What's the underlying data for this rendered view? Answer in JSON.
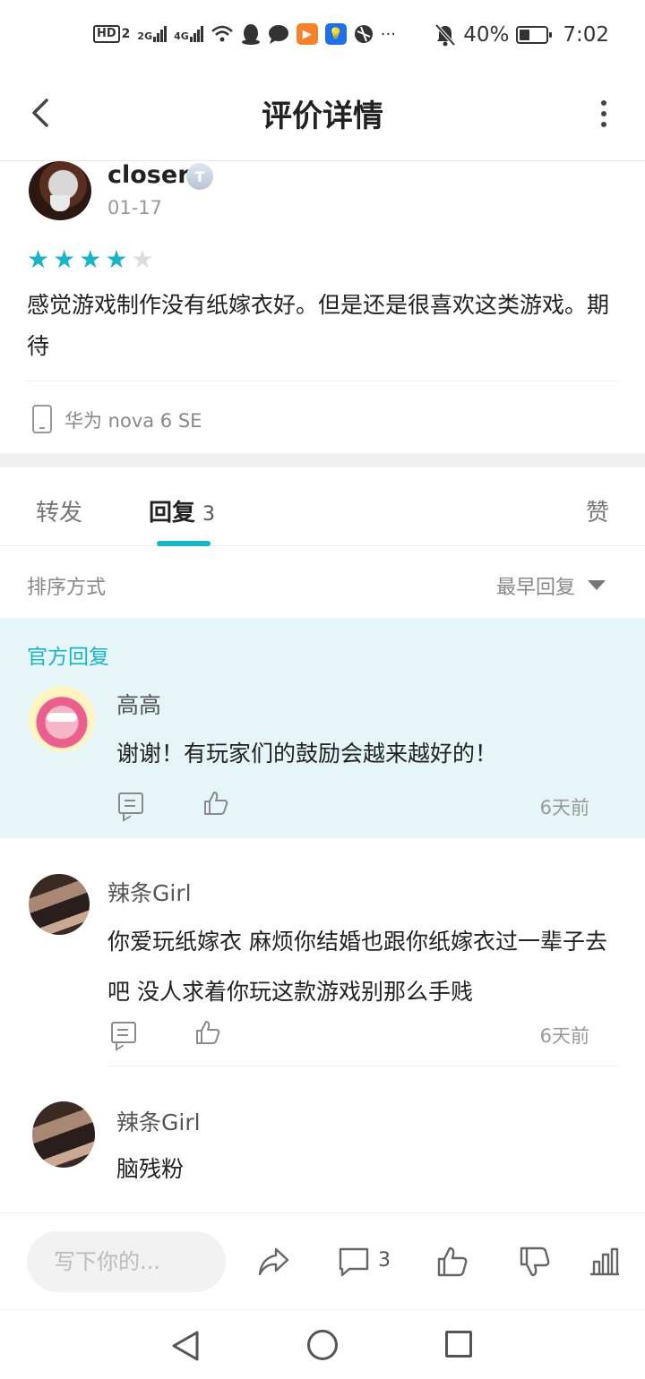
{
  "status_bar": {
    "hd": "HD",
    "sim": "2",
    "net1": "2G",
    "net2": "4G",
    "more": "···",
    "battery": "40%",
    "time": "7:02"
  },
  "header": {
    "title": "评价详情"
  },
  "review": {
    "user_name": "closer",
    "badge": "T",
    "date": "01-17",
    "rating": 4,
    "rating_max": 5,
    "text": "感觉游戏制作没有纸嫁衣好。但是还是很喜欢这类游戏。期待",
    "device": "华为 nova 6 SE"
  },
  "tabs": {
    "forward": "转发",
    "reply": "回复",
    "reply_count": "3",
    "like": "赞"
  },
  "sort": {
    "label": "排序方式",
    "value": "最早回复"
  },
  "official": {
    "label": "官方回复",
    "name": "高高",
    "text": "谢谢！有玩家们的鼓励会越来越好的！",
    "time": "6天前"
  },
  "replies": [
    {
      "name": "辣条Girl",
      "text": "你爱玩纸嫁衣 麻烦你结婚也跟你纸嫁衣过一辈子去吧 没人求着你玩这款游戏别那么手贱",
      "time": "6天前"
    },
    {
      "name": "辣条Girl",
      "text": "脑残粉"
    }
  ],
  "action_bar": {
    "input_placeholder": "写下你的...",
    "comment_count": "3"
  },
  "colors": {
    "accent": "#19b5c7",
    "official_bg": "#e6f5f8"
  }
}
